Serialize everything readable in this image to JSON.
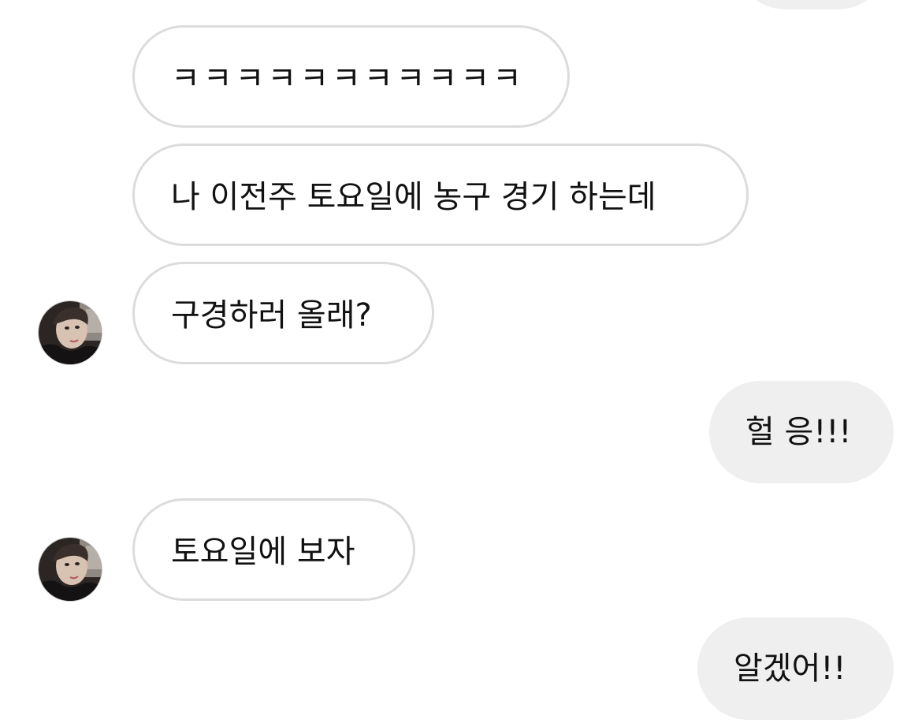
{
  "chat": {
    "messages": [
      {
        "id": "m0",
        "direction": "outgoing",
        "text": ""
      },
      {
        "id": "m1",
        "direction": "incoming",
        "text": "ㅋㅋㅋㅋㅋㅋㅋㅋㅋㅋㅋ"
      },
      {
        "id": "m2",
        "direction": "incoming",
        "text": "나 이전주 토요일에 농구 경기 하는데"
      },
      {
        "id": "m3",
        "direction": "incoming",
        "text": "구경하러 올래?"
      },
      {
        "id": "m4",
        "direction": "outgoing",
        "text": "헐 응!!!"
      },
      {
        "id": "m5",
        "direction": "incoming",
        "text": "토요일에 보자"
      },
      {
        "id": "m6",
        "direction": "outgoing",
        "text": "알겠어!!"
      }
    ],
    "avatar_icon": "contact-avatar-photo"
  },
  "colors": {
    "incoming_bubble_bg": "#ffffff",
    "incoming_bubble_border": "#dcdcdc",
    "outgoing_bubble_bg": "#efefef",
    "text": "#111111"
  }
}
